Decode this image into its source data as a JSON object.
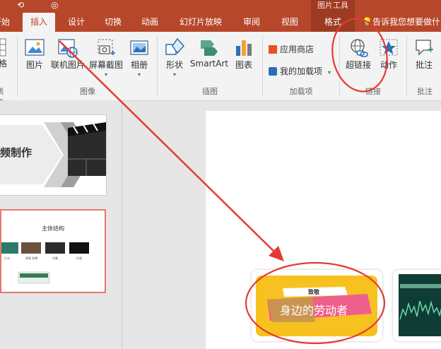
{
  "context_tab": {
    "label": "图片工具"
  },
  "tabs": [
    {
      "label": "开始"
    },
    {
      "label": "插入"
    },
    {
      "label": "设计"
    },
    {
      "label": "切换"
    },
    {
      "label": "动画"
    },
    {
      "label": "幻灯片放映"
    },
    {
      "label": "审阅"
    },
    {
      "label": "视图"
    },
    {
      "label": "格式"
    }
  ],
  "tell_me": "告诉我您想要做什",
  "ribbon": {
    "table_btn": "表格",
    "table_group": "表格",
    "image_group": {
      "label": "图像",
      "picture": "图片",
      "online_picture": "联机图片",
      "screenshot": "屏幕截图",
      "album": "相册"
    },
    "illustration_group": {
      "label": "插图",
      "shapes": "形状",
      "smartart": "SmartArt",
      "chart": "图表"
    },
    "addins_group": {
      "label": "加载项",
      "store": "应用商店",
      "my_addins": "我的加载项"
    },
    "links_group": {
      "label": "链接",
      "hyperlink": "超链接",
      "action": "动作"
    },
    "comments_group": {
      "label": "批注",
      "comment": "批注"
    }
  },
  "slide1": {
    "title": "频制作"
  },
  "slide2": {
    "title": "主体结构",
    "labels": [
      "片头",
      "视频 剪辑 ",
      "字幕",
      "片尾"
    ]
  },
  "card1": {
    "small": "致敬",
    "big": "身边的劳动者"
  },
  "colors": {
    "accent": "#b7472a",
    "annotation": "#e53935",
    "selection": "#e5786a"
  }
}
